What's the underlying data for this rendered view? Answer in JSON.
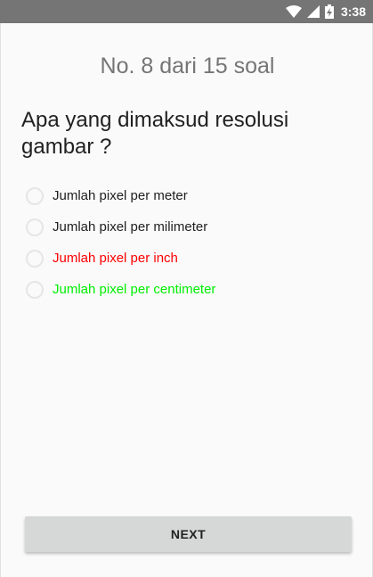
{
  "status_bar": {
    "time": "3:38",
    "icons": [
      "wifi-icon",
      "signal-icon",
      "battery-charging-icon"
    ]
  },
  "quiz": {
    "counter": "No. 8 dari 15 soal",
    "question": "Apa yang dimaksud resolusi gambar ?",
    "options": [
      {
        "label": "Jumlah pixel per meter",
        "color": "#212121"
      },
      {
        "label": "Jumlah pixel per milimeter",
        "color": "#212121"
      },
      {
        "label": "Jumlah pixel per inch",
        "color": "#ff0000"
      },
      {
        "label": "Jumlah pixel per centimeter",
        "color": "#00ee00"
      }
    ],
    "next_label": "NEXT"
  }
}
